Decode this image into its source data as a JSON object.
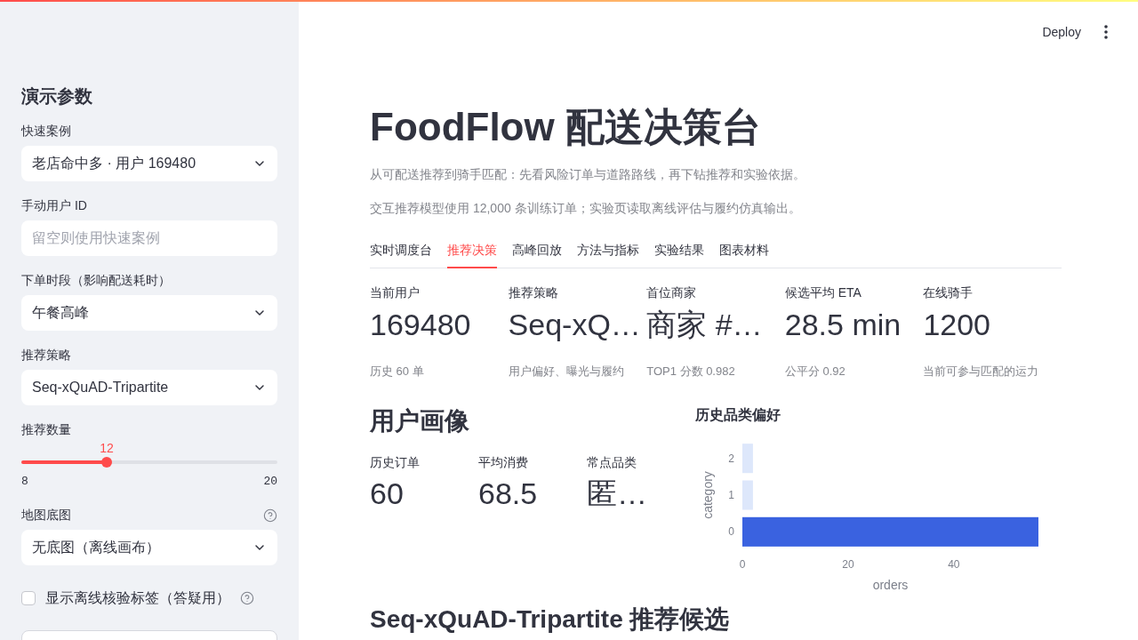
{
  "header": {
    "deploy": "Deploy"
  },
  "sidebar": {
    "title": "演示参数",
    "controls": [
      {
        "kind": "select",
        "label": "快速案例",
        "value": "老店命中多 · 用户 169480"
      },
      {
        "kind": "input",
        "label": "手动用户 ID",
        "placeholder": "留空则使用快速案例"
      },
      {
        "kind": "select",
        "label": "下单时段（影响配送耗时）",
        "value": "午餐高峰"
      },
      {
        "kind": "select",
        "label": "推荐策略",
        "value": "Seq-xQuAD-Tripartite"
      },
      {
        "kind": "slider",
        "label": "推荐数量",
        "reading": "12",
        "level": 0.3333,
        "min": "8",
        "max": "20"
      },
      {
        "kind": "select",
        "label": "地图底图",
        "value": "无底图（离线画布）",
        "help": true
      },
      {
        "kind": "checkbox",
        "label": "显示离线核验标签（答疑用）",
        "checked": false,
        "help": true
      },
      {
        "kind": "button"
      }
    ]
  },
  "main": {
    "title": "FoodFlow 配送决策台",
    "captions": [
      "从可配送推荐到骑手匹配：先看风险订单与道路路线，再下钻推荐和实验依据。",
      "交互推荐模型使用 12,000 条训练订单；实验页读取离线评估与履约仿真输出。"
    ],
    "tabs": [
      {
        "label": "实时调度台",
        "selected": false
      },
      {
        "label": "推荐决策",
        "selected": true
      },
      {
        "label": "高峰回放",
        "selected": false
      },
      {
        "label": "方法与指标",
        "selected": false
      },
      {
        "label": "实验结果",
        "selected": false
      },
      {
        "label": "图表材料",
        "selected": false
      }
    ],
    "metrics": [
      {
        "label": "当前用户",
        "value": "169480",
        "note": "历史 60 单"
      },
      {
        "label": "推荐策略",
        "value": "Seq-xQ…",
        "note": "用户偏好、曝光与履约"
      },
      {
        "label": "首位商家",
        "value": "商家 #…",
        "note": "TOP1 分数 0.982"
      },
      {
        "label": "候选平均 ETA",
        "value": "28.5 min",
        "note": "公平分 0.92"
      },
      {
        "label": "在线骑手",
        "value": "1200",
        "note": "当前可参与匹配的运力"
      }
    ],
    "profile": {
      "heading": "用户画像",
      "metrics": [
        {
          "label": "历史订单",
          "value": "60"
        },
        {
          "label": "平均消费",
          "value": "68.5"
        },
        {
          "label": "常点品类",
          "value": "匿…"
        }
      ],
      "chart_data": {
        "type": "bar",
        "title": "历史品类偏好",
        "orientation": "horizontal",
        "categories": [
          "2",
          "1",
          "0"
        ],
        "values": [
          2,
          2,
          56
        ],
        "colors": [
          "#dde7fb",
          "#dde7fb",
          "#3a62e0"
        ],
        "xlabel": "orders",
        "ylabel": "category",
        "xlim": [
          0,
          56
        ],
        "xticks": [
          0,
          20,
          40
        ]
      }
    },
    "next_heading": "Seq-xQuAD-Tripartite 推荐候选"
  }
}
